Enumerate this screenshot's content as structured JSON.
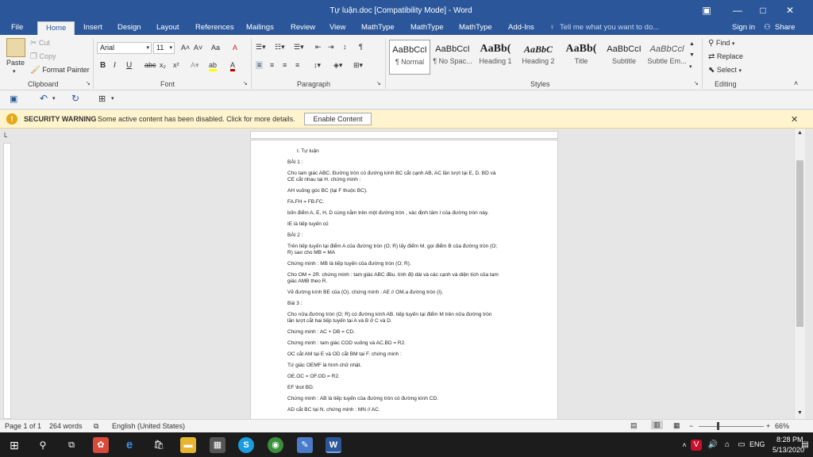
{
  "titlebar": {
    "title": "Tự luận.doc [Compatibility Mode] - Word",
    "restore_icon": "□",
    "minimize_icon": "—",
    "close_icon": "✕"
  },
  "tabs": [
    "File",
    "Home",
    "Insert",
    "Design",
    "Layout",
    "References",
    "Mailings",
    "Review",
    "View",
    "MathType",
    "MathType",
    "MathType",
    "Add-Ins"
  ],
  "tell_me": "Tell me what you want to do...",
  "signin": "Sign in",
  "share": "Share",
  "clipboard": {
    "paste": "Paste",
    "cut": "Cut",
    "copy": "Copy",
    "format_painter": "Format Painter",
    "label": "Clipboard"
  },
  "font": {
    "name": "Arial",
    "size": "11",
    "label": "Font",
    "bold": "B",
    "italic": "I",
    "underline": "U",
    "strike": "abc",
    "sub": "x₂",
    "sup": "x²",
    "grow": "A˄",
    "shrink": "A˅",
    "case": "Aa",
    "clear": "A",
    "highlight": "ab",
    "color": "A"
  },
  "paragraph": {
    "label": "Paragraph"
  },
  "styles": {
    "label": "Styles",
    "items": [
      {
        "sample": "AaBbCcI",
        "name": "¶ Normal"
      },
      {
        "sample": "AaBbCcI",
        "name": "¶ No Spac..."
      },
      {
        "sample": "AaBb(",
        "name": "Heading 1"
      },
      {
        "sample": "AaBbC",
        "name": "Heading 2"
      },
      {
        "sample": "AaBb(",
        "name": "Title"
      },
      {
        "sample": "AaBbCcI",
        "name": "Subtitle"
      },
      {
        "sample": "AaBbCcl",
        "name": "Subtle Em..."
      }
    ]
  },
  "editing": {
    "find": "Find",
    "replace": "Replace",
    "select": "Select",
    "label": "Editing"
  },
  "warning": {
    "title": "SECURITY WARNING",
    "message": "Some active content has been disabled. Click for more details.",
    "button": "Enable Content"
  },
  "document": {
    "lines": [
      "I.    Tự luận",
      "BÀI 1 :",
      "Cho tam giác ABC. Đường tròn có đường kính BC cắt cạnh AB, AC lần lượt tại E, D. BD và",
      "CE cắt nhau tại H. chứng minh :",
      "AH vuông góc BC (tại F thuộc BC).",
      "FA.FH = FB.FC.",
      "bốn điểm A, E, H, D cùng nằm trên một đường tròn , xác định tâm I của đường tròn này.",
      "IE là tiếp tuyến củ",
      "BÀI 2 :",
      "Trên tiếp tuyến tại điểm A của đường tròn (O; R) lấy điểm M. gọi điểm B của đường tròn (O;",
      "R) sao cho MB = MA",
      "Chứng minh : MB là tiếp tuyến của đường tròn (O; R).",
      "Cho OM = 2R. chứng minh : tam giác ABC đều. tính độ dài và các cạnh và diện tích của tam",
      "giác AMB theo R.",
      "Vẽ đường kính BE của (O). chứng minh : AE // OM.a đường tròn (I).",
      "Bài 3 :",
      "Cho nửa đường tròn (O; R) có đường kính AB. tiếp tuyến tại điểm M trên nửa đường tròn",
      "lần lượt cắt hai tiếp tuyến tại A và B ở C và D.",
      "Chứng minh : AC + DB = CD.",
      "Chứng minh : tam giác COD vuông và AC.BD = R2.",
      "OC cắt AM tại E và OD cắt BM tại F. chứng minh :",
      "Tứ giác OEMF là hình chữ nhật.",
      "OE.OC = OF.OD = R2.",
      "EF \\bot   BD.",
      "Chứng minh : AB là tiếp tuyến của đường tròn có đường kính CD.",
      "AD cắt BC tại N. chứng minh : MN // AC."
    ]
  },
  "status": {
    "page": "Page 1 of 1",
    "words": "264 words",
    "language": "English (United States)",
    "zoom": "66%"
  },
  "taskbar": {
    "lang": "ENG",
    "time": "8:28 PM",
    "date": "5/13/2020"
  }
}
